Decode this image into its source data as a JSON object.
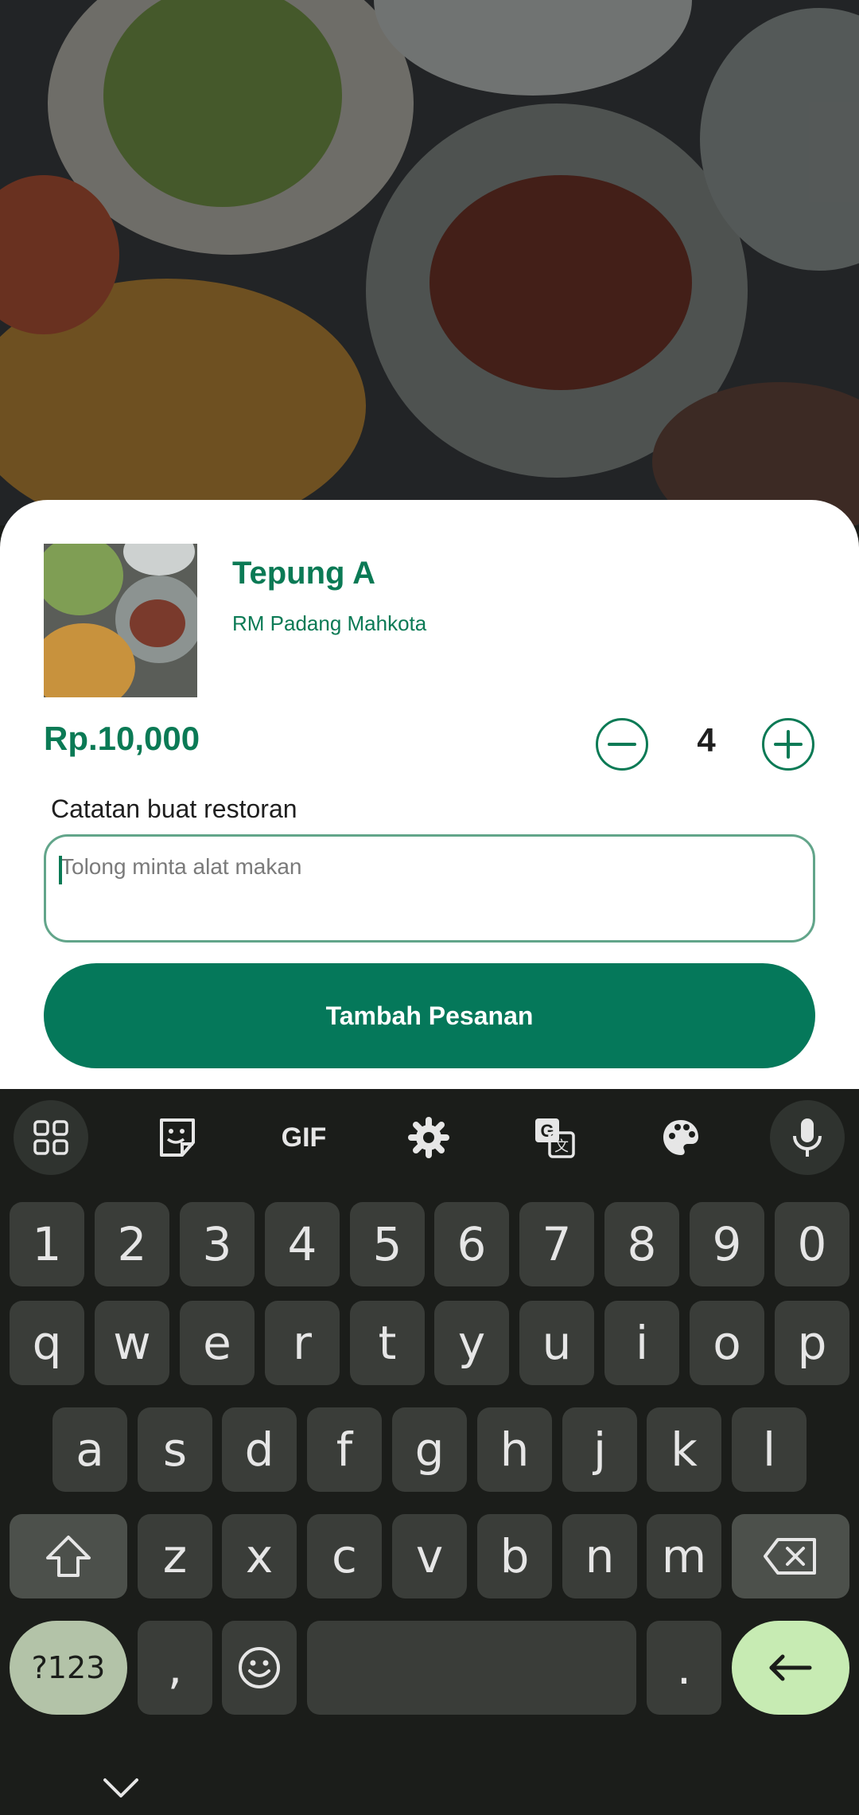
{
  "sheet": {
    "item_name": "Tepung A",
    "restaurant": "RM Padang Mahkota",
    "price": "Rp.10,000",
    "quantity": "4",
    "note_label": "Catatan buat restoran",
    "note_placeholder": "Tolong minta alat makan",
    "note_value": "",
    "add_button_label": "Tambah Pesanan"
  },
  "keyboard": {
    "toolbar": [
      {
        "icon": "apps-grid-icon"
      },
      {
        "icon": "sticker-icon"
      },
      {
        "icon": "gif-icon",
        "label": "GIF"
      },
      {
        "icon": "settings-gear-icon"
      },
      {
        "icon": "translate-icon"
      },
      {
        "icon": "palette-icon"
      },
      {
        "icon": "microphone-icon"
      }
    ],
    "row_numbers": [
      "1",
      "2",
      "3",
      "4",
      "5",
      "6",
      "7",
      "8",
      "9",
      "0"
    ],
    "row_1": [
      "q",
      "w",
      "e",
      "r",
      "t",
      "y",
      "u",
      "i",
      "o",
      "p"
    ],
    "row_2": [
      "a",
      "s",
      "d",
      "f",
      "g",
      "h",
      "j",
      "k",
      "l"
    ],
    "row_3": [
      "z",
      "x",
      "c",
      "v",
      "b",
      "n",
      "m"
    ],
    "symbols_label": "?123",
    "comma": ",",
    "period": "."
  },
  "colors": {
    "brand_green": "#0b7a55",
    "button_green": "#05785a",
    "keyboard_bg": "#1b1d1a",
    "enter_key": "#c7ebb3"
  }
}
